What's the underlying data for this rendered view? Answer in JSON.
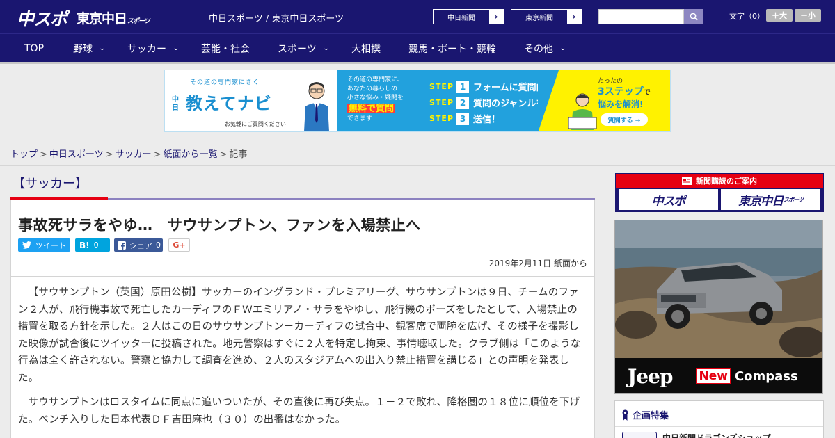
{
  "header": {
    "logo_main": "中スポ",
    "logo_tokyo": "東京中日",
    "logo_tokyo_small": "スポーツ",
    "site_title": "中日スポーツ / 東京中日スポーツ",
    "paper_links": [
      {
        "label": "中日新聞",
        "arrow": "›"
      },
      {
        "label": "東京新聞",
        "arrow": "›"
      }
    ],
    "search": {
      "placeholder": ""
    },
    "font_size": {
      "label": "文字（0）",
      "plus": "＋大",
      "minus": "－小"
    }
  },
  "nav": {
    "items": [
      {
        "label": "TOP",
        "chevron": ""
      },
      {
        "label": "野球",
        "chevron": "⌄"
      },
      {
        "label": "サッカー",
        "chevron": "⌄"
      },
      {
        "label": "芸能・社会",
        "chevron": ""
      },
      {
        "label": "スポーツ",
        "chevron": "⌄"
      },
      {
        "label": "大相撲",
        "chevron": ""
      },
      {
        "label": "競馬・ボート・競輪",
        "chevron": ""
      },
      {
        "label": "その他",
        "chevron": "⌄"
      }
    ]
  },
  "banner": {
    "sub": "その道の専門家にきく",
    "brand_small": "中日",
    "title": "教えてナビ",
    "note": "お気軽にご質問ください!",
    "mid_lines": [
      "その道の専門家に、",
      "あなたの暮らしの",
      "小さな悩み・疑問を"
    ],
    "mid_free": "無料で質問",
    "mid_last": "できます",
    "steps": [
      {
        "word": "STEP",
        "num": "1",
        "text": "フォームに質問内容を入力"
      },
      {
        "word": "STEP",
        "num": "2",
        "text": "質問のジャンルを選択"
      },
      {
        "word": "STEP",
        "num": "3",
        "text": "送信！"
      }
    ],
    "right_top": "たったの",
    "right_big": "3ステップ",
    "right_big_suffix": "で",
    "right_big2": "悩みを解消!",
    "right_btn": "質問する →"
  },
  "breadcrumb": {
    "items": [
      "トップ",
      "中日スポーツ",
      "サッカー",
      "紙面から一覧"
    ],
    "current": "記事",
    "sep": ">"
  },
  "article": {
    "category": "【サッカー】",
    "headline": "事故死サラをやゆ…　サウサンプトン、ファンを入場禁止へ",
    "share": {
      "twitter": "ツイート",
      "hatena_icon": "B!",
      "hatena_count": "0",
      "facebook": "シェア",
      "facebook_count": "0",
      "gplus": "G+"
    },
    "dateline": "2019年2月11日 紙面から",
    "paragraphs": [
      "【サウサンプトン（英国）原田公樹】サッカーのイングランド・プレミアリーグ、サウサンプトンは９日、チームのファン２人が、飛行機事故で死亡したカーディフのＦＷエミリアノ・サラをやゆし、飛行機のポーズをしたとして、入場禁止の措置を取る方針を示した。２人はこの日のサウサンプトン－カーディフの試合中、観客席で両腕を広げ、その様子を撮影した映像が試合後にツイッターに投稿された。地元警察はすぐに２人を特定し拘束、事情聴取した。クラブ側は「このような行為は全く許されない。警察と協力して調査を進め、２人のスタジアムへの出入り禁止措置を講じる」との声明を発表した。",
      "サウサンプトンはロスタイムに同点に追いついたが、その直後に再び失点。１－２で敗れ、降格圏の１８位に順位を下げた。ベンチ入りした日本代表ＤＦ吉田麻也（３０）の出番はなかった。"
    ]
  },
  "sidebar": {
    "subscription": {
      "title": "新聞購読のご案内",
      "logo1": "中スポ",
      "logo2": "東京中日",
      "logo2_small": "スポーツ"
    },
    "ad": {
      "brand": "Jeep",
      "badge": "New",
      "model": "Compass"
    },
    "feature": {
      "title": "企画特集",
      "item": "中日新聞ドラゴンズショップ"
    }
  },
  "colors": {
    "brand_navy": "#1a1670",
    "accent_red": "#e60012",
    "twitter": "#1da1f2",
    "hatena": "#00a4de",
    "facebook": "#3b5998"
  }
}
